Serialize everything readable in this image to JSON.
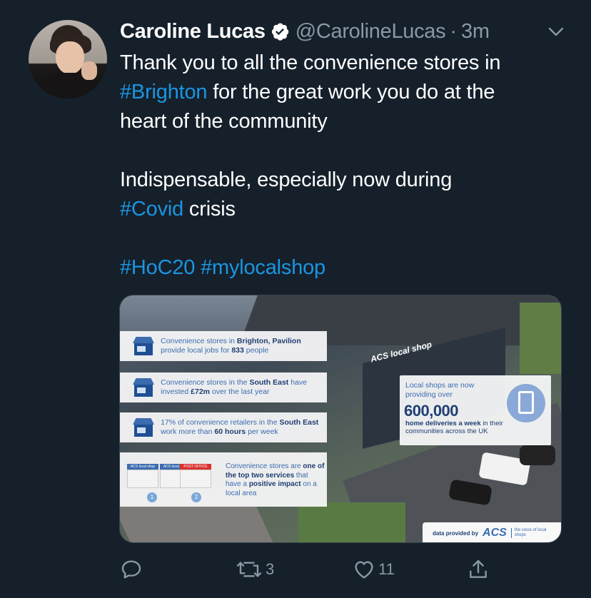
{
  "tweet": {
    "author_name": "Caroline Lucas",
    "handle": "@CarolineLucas",
    "separator": "·",
    "time": "3m",
    "text": {
      "line1": "Thank you to all the convenience stores in",
      "line2_tag": "#Brighton",
      "line2_rest": " for the great work you do at the",
      "line3": "heart of the community",
      "line4": "Indispensable, especially now during",
      "line5_tag": "#Covid",
      "line5_rest": " crisis",
      "tag1": "#HoC20",
      "tag2": "#mylocalshop"
    }
  },
  "infographic": {
    "store_sign": "ACS local shop",
    "band1": {
      "pre": "Convenience stores in ",
      "bold1": "Brighton, Pavilion",
      "mid": " provide local jobs for ",
      "bold2": "833",
      "post": " people"
    },
    "band2": {
      "pre": "Convenience stores in the ",
      "bold1": "South East",
      "mid": " have invested ",
      "bold2": "£72m",
      "post": " over the last year"
    },
    "band3": {
      "pre": "17% of convenience retailers in the ",
      "bold1": "South East",
      "mid": " work more than ",
      "bold2": "60 hours",
      "post": " per week"
    },
    "band4": {
      "pre": "Convenience stores are ",
      "bold1": "one of the top two services",
      "mid": " that have a ",
      "bold2": "positive impact",
      "post": " on a local area"
    },
    "shop1_sign": "ACS local shop",
    "shop2_sign": "POST OFFICE",
    "num1": "1",
    "num2": "2",
    "stat": {
      "line1": "Local shops are now providing over",
      "big": "600,000",
      "line2_bold": "home deliveries a week",
      "line2_rest": " in their communities across the UK"
    },
    "credit": {
      "provided": "data provided by",
      "brand": "ACS",
      "voice": "the voice of local shops"
    }
  },
  "actions": {
    "retweets": "3",
    "likes": "11"
  },
  "colors": {
    "background": "#15202b",
    "link": "#1b95e0",
    "muted": "#8899a6"
  },
  "icons": [
    "verified-badge-icon",
    "chevron-down-icon",
    "reply-icon",
    "retweet-icon",
    "like-icon",
    "share-icon"
  ]
}
